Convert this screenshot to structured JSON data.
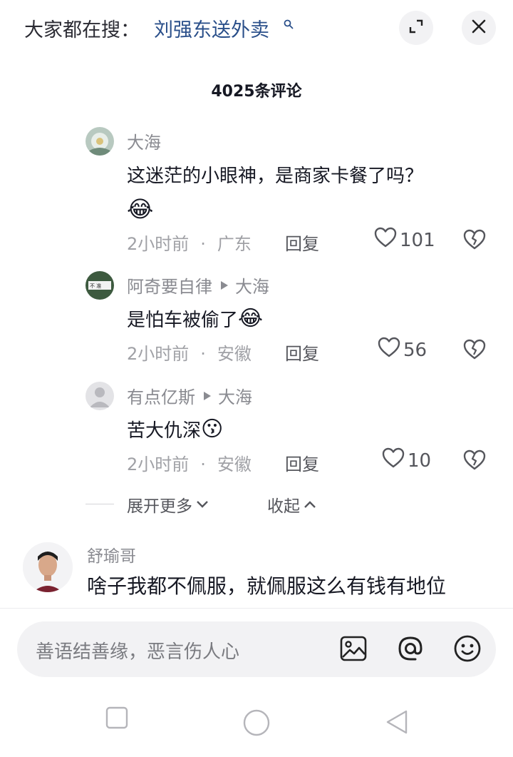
{
  "search": {
    "prefix": "大家都在搜：",
    "term": "刘强东送外卖"
  },
  "header": {
    "comment_count": "4025条评论"
  },
  "replies": [
    {
      "author": "大海",
      "reply_to": "",
      "text": "这迷茫的小眼神，是商家卡餐了吗？",
      "emoji": "😂",
      "time": "2小时前",
      "location": "广东",
      "reply_label": "回复",
      "likes": "101"
    },
    {
      "author": "阿奇要自律",
      "reply_to": "大海",
      "text": "是怕车被偷了",
      "emoji": "😂",
      "time": "2小时前",
      "location": "安徽",
      "reply_label": "回复",
      "likes": "56"
    },
    {
      "author": "有点亿斯",
      "reply_to": "大海",
      "text": "苦大仇深",
      "emoji": "😗",
      "time": "2小时前",
      "location": "安徽",
      "reply_label": "回复",
      "likes": "10"
    }
  ],
  "thread_controls": {
    "expand_more": "展开更多",
    "collapse": "收起"
  },
  "main_comment": {
    "author": "舒瑜哥",
    "text": "啥子我都不佩服，就佩服这么有钱有地位"
  },
  "input": {
    "placeholder": "善语结善缘，恶言伤人心"
  },
  "icons": {
    "search": "search-icon",
    "expand": "expand-icon",
    "close": "close-icon",
    "like": "heart-icon",
    "dislike": "broken-heart-icon",
    "image": "image-icon",
    "mention": "at-icon",
    "emoji": "emoji-icon",
    "nav_recents": "square-icon",
    "nav_home": "circle-icon",
    "nav_back": "triangle-back-icon"
  },
  "colors": {
    "search_term": "#2a4f8a",
    "secondary_text": "#8a8b91",
    "input_bg": "#f2f2f4"
  }
}
